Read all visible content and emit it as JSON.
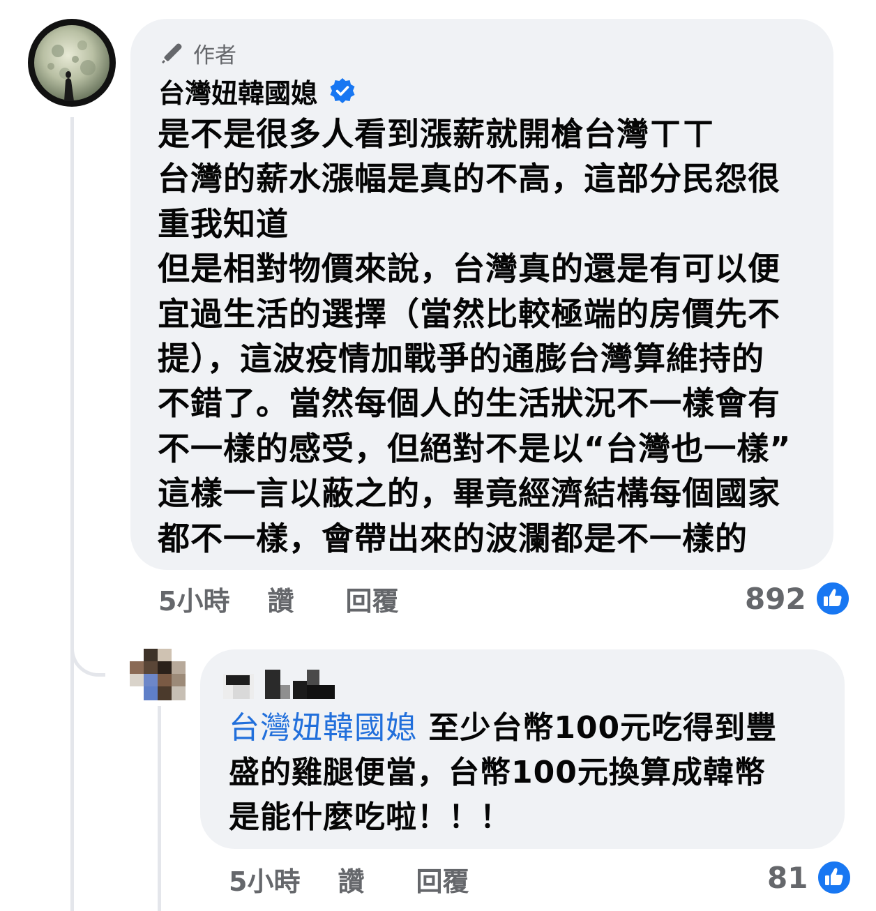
{
  "colors": {
    "bubble_bg": "#f0f2f5",
    "secondary_text": "#65676b",
    "primary_text": "#050505",
    "link_blue": "#216fdb",
    "like_blue": "#1877f2"
  },
  "comment": {
    "author_badge": "作者",
    "author_name": "台灣妞韓國媳",
    "verified": true,
    "lines": [
      "是不是很多人看到漲薪就開槍台灣ㄒㄒ",
      "台灣的薪水漲幅是真的不高，這部分民怨很",
      "重我知道",
      "但是相對物價來說，台灣真的還是有可以便",
      "宜過生活的選擇（當然比較極端的房價先不",
      "提），這波疫情加戰爭的通膨台灣算維持的",
      "不錯了。當然每個人的生活狀況不一樣會有",
      "不一樣的感受，但絕對不是以“台灣也一樣”",
      "這樣一言以蔽之的，畢竟經濟結構每個國家",
      "都不一樣，會帶出來的波瀾都是不一樣的"
    ],
    "time": "5小時",
    "like_label": "讚",
    "reply_label": "回覆",
    "like_count": "892"
  },
  "reply": {
    "mention": "台灣妞韓國媳",
    "line1_rest": " 至少台幣100元吃得到豐",
    "lines": [
      "盛的雞腿便當，台幣100元換算成韓幣",
      "是能什麼吃啦！！！"
    ],
    "time": "5小時",
    "like_label": "讚",
    "reply_label": "回覆",
    "like_count": "81"
  }
}
